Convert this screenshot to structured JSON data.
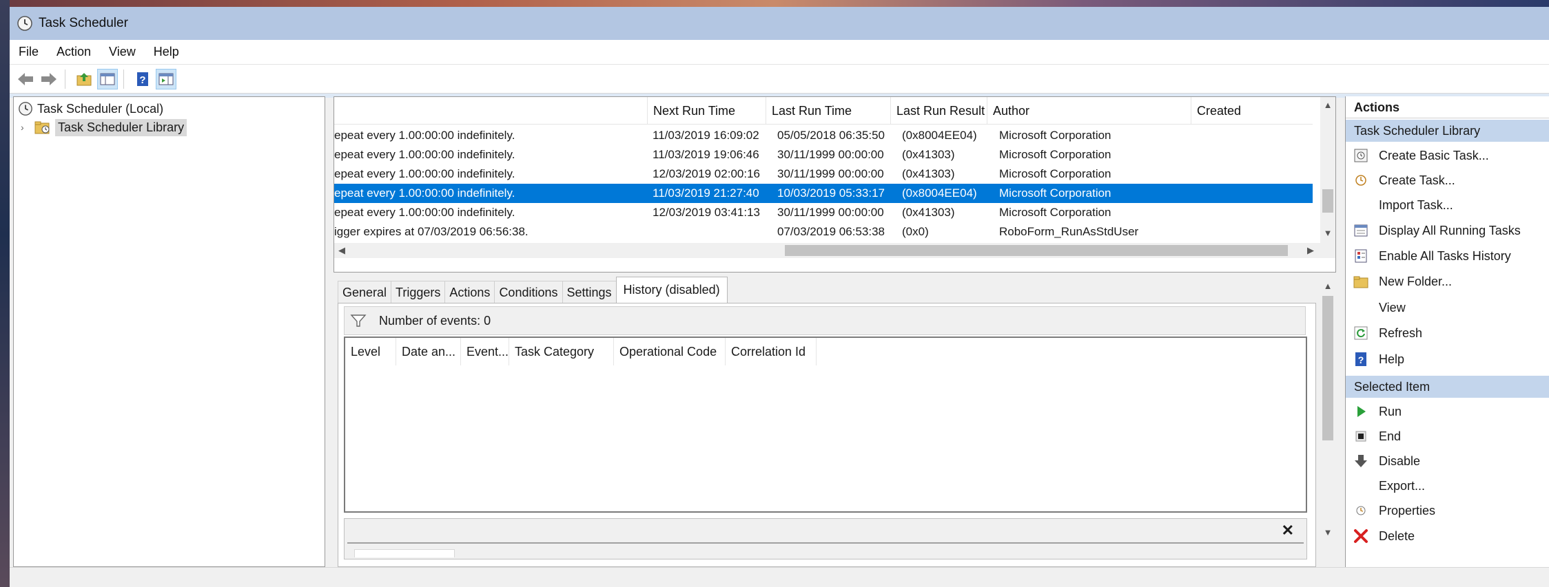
{
  "window": {
    "title": "Task Scheduler"
  },
  "menu": [
    "File",
    "Action",
    "View",
    "Help"
  ],
  "toolbar": {
    "buttons": [
      "back-icon",
      "forward-icon",
      "up-folder-icon",
      "show-hide-tree-icon",
      "help-icon",
      "show-hide-action-pane-icon"
    ]
  },
  "tree": {
    "root": "Task Scheduler (Local)",
    "library": "Task Scheduler Library"
  },
  "tasklist": {
    "columns": [
      "Next Run Time",
      "Last Run Time",
      "Last Run Result",
      "Author",
      "Created"
    ],
    "rows": [
      {
        "trigger": "epeat every 1.00:00:00 indefinitely.",
        "next": "11/03/2019 16:09:02",
        "last": "05/05/2018 06:35:50",
        "result": "(0x8004EE04)",
        "author": "Microsoft Corporation",
        "created": ""
      },
      {
        "trigger": "epeat every 1.00:00:00 indefinitely.",
        "next": "11/03/2019 19:06:46",
        "last": "30/11/1999 00:00:00",
        "result": "(0x41303)",
        "author": "Microsoft Corporation",
        "created": ""
      },
      {
        "trigger": "epeat every 1.00:00:00 indefinitely.",
        "next": "12/03/2019 02:00:16",
        "last": "30/11/1999 00:00:00",
        "result": "(0x41303)",
        "author": "Microsoft Corporation",
        "created": ""
      },
      {
        "trigger": "epeat every 1.00:00:00 indefinitely.",
        "next": "11/03/2019 21:27:40",
        "last": "10/03/2019 05:33:17",
        "result": "(0x8004EE04)",
        "author": "Microsoft Corporation",
        "created": "",
        "selected": true
      },
      {
        "trigger": "epeat every 1.00:00:00 indefinitely.",
        "next": "12/03/2019 03:41:13",
        "last": "30/11/1999 00:00:00",
        "result": "(0x41303)",
        "author": "Microsoft Corporation",
        "created": ""
      },
      {
        "trigger": "igger expires at 07/03/2019 06:56:38.",
        "next": "",
        "last": "07/03/2019 06:53:38",
        "result": "(0x0)",
        "author": "RoboForm_RunAsStdUser",
        "created": ""
      }
    ]
  },
  "tabs": [
    "General",
    "Triggers",
    "Actions",
    "Conditions",
    "Settings",
    "History (disabled)"
  ],
  "history": {
    "events_label": "Number of events: 0",
    "columns": [
      "Level",
      "Date an...",
      "Event...",
      "Task Category",
      "Operational Code",
      "Correlation Id"
    ]
  },
  "actions_pane": {
    "title": "Actions",
    "section1": "Task Scheduler Library",
    "items1": [
      {
        "label": "Create Basic Task...",
        "icon": "create-basic-task-icon"
      },
      {
        "label": "Create Task...",
        "icon": "create-task-icon"
      },
      {
        "label": "Import Task...",
        "icon": ""
      },
      {
        "label": "Display All Running Tasks",
        "icon": "running-tasks-icon"
      },
      {
        "label": "Enable All Tasks History",
        "icon": "history-icon"
      },
      {
        "label": "New Folder...",
        "icon": "folder-icon"
      },
      {
        "label": "View",
        "icon": ""
      },
      {
        "label": "Refresh",
        "icon": "refresh-icon"
      },
      {
        "label": "Help",
        "icon": "help-icon"
      }
    ],
    "section2": "Selected Item",
    "items2": [
      {
        "label": "Run",
        "icon": "run-icon"
      },
      {
        "label": "End",
        "icon": "end-icon"
      },
      {
        "label": "Disable",
        "icon": "disable-icon"
      },
      {
        "label": "Export...",
        "icon": ""
      },
      {
        "label": "Properties",
        "icon": "properties-icon"
      },
      {
        "label": "Delete",
        "icon": "delete-icon"
      }
    ]
  },
  "colors": {
    "selection": "#0078d7",
    "section_header": "#c3d5ec",
    "titlebar": "#b3c6e2"
  }
}
